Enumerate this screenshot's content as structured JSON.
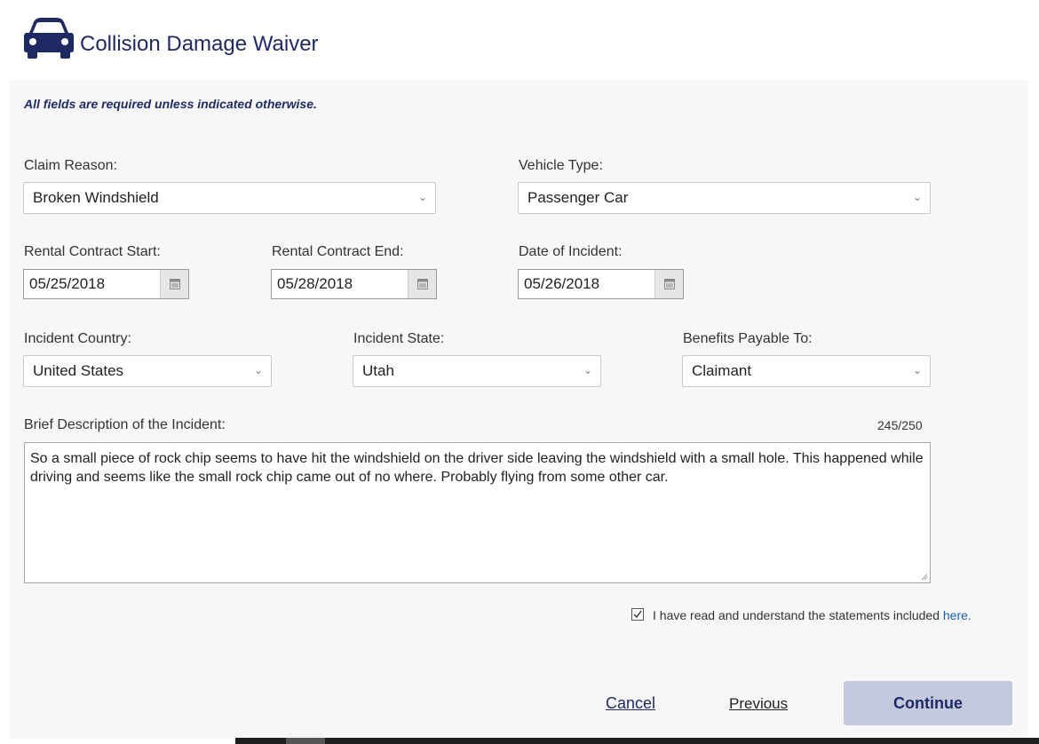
{
  "header": {
    "title": "Collision Damage Waiver",
    "icon": "car-icon"
  },
  "note": "All fields are required unless indicated otherwise.",
  "fields": {
    "claim_reason": {
      "label": "Claim Reason:",
      "value": "Broken Windshield"
    },
    "vehicle_type": {
      "label": "Vehicle Type:",
      "value": "Passenger Car"
    },
    "rental_start": {
      "label": "Rental Contract Start:",
      "value": "05/25/2018"
    },
    "rental_end": {
      "label": "Rental Contract End:",
      "value": "05/28/2018"
    },
    "incident_date": {
      "label": "Date of Incident:",
      "value": "05/26/2018"
    },
    "incident_country": {
      "label": "Incident Country:",
      "value": "United States"
    },
    "incident_state": {
      "label": "Incident State:",
      "value": "Utah"
    },
    "benefits_payable": {
      "label": "Benefits Payable To:",
      "value": "Claimant"
    },
    "description": {
      "label": "Brief Description of the Incident:",
      "counter": "245/250",
      "value": "So a small piece of rock chip seems to have hit the windshield on the driver side leaving the windshield with a small hole. This happened while driving and seems like the small rock chip came out of no where. Probably flying from some other car."
    }
  },
  "acknowledgement": {
    "checked": true,
    "text": "I have read and understand the statements included ",
    "link": "here."
  },
  "actions": {
    "cancel": "Cancel",
    "previous": "Previous",
    "continue": "Continue"
  },
  "colors": {
    "brand": "#1f2a63",
    "link": "#1a5fb4",
    "continue_bg": "#c5c9de"
  }
}
